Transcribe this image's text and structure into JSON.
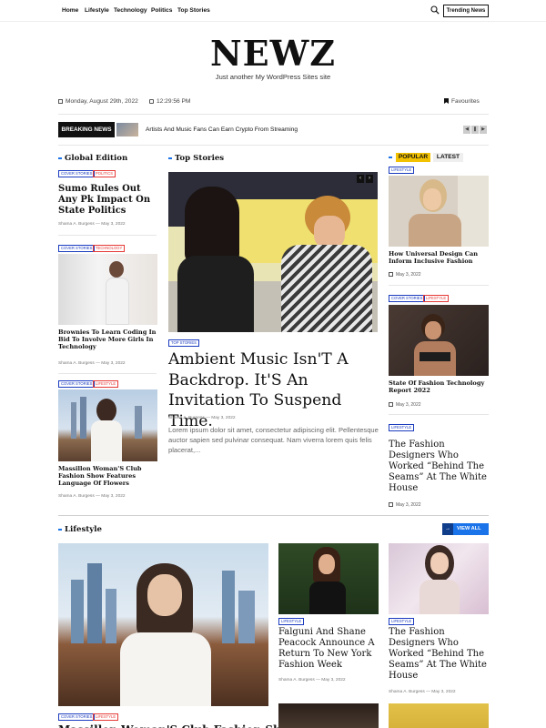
{
  "nav": {
    "items": [
      "Home",
      "Lifestyle",
      "Technology",
      "Politics",
      "Top Stories"
    ],
    "trending_label": "Trending News",
    "search_icon": "search-icon"
  },
  "site": {
    "title": "NEWZ",
    "tagline": "Just another My WordPress Sites site"
  },
  "meta": {
    "date": "Monday, August 29th, 2022",
    "time": "12:29:56 PM",
    "favourites": "Favourites"
  },
  "breaking": {
    "label": "BREAKING NEWS",
    "headline": "Artists And Music Fans Can Earn Crypto From Streaming"
  },
  "global_edition": {
    "heading": "Global Edition",
    "posts": [
      {
        "badges": [
          "COVER STORIES",
          "POLITICS"
        ],
        "title": "Sumo Rules Out Any Pk Impact On State Politics",
        "author": "Shama A. Burgess",
        "date": "May 3, 2022"
      },
      {
        "badges": [
          "COVER STORIES",
          "TECHNOLOGY"
        ],
        "title": "Brownies To Learn Coding In Bid To Involve More Girls In Technology",
        "author": "Shama A. Burgess",
        "date": "May 3, 2022"
      },
      {
        "badges": [
          "COVER STORIES",
          "LIFESTYLE"
        ],
        "title": "Massillon Woman'S Club Fashion Show Features Language Of Flowers",
        "author": "Shama A. Burgess",
        "date": "May 3, 2022"
      }
    ]
  },
  "top_stories": {
    "heading": "Top Stories",
    "badge": "TOP STORIES",
    "title": "Ambient Music Isn'T A Backdrop. It'S An Invitation To Suspend Time.",
    "author": "Shama A. Burgess",
    "date": "May 3, 2022",
    "excerpt": "Lorem ipsum dolor sit amet, consectetur adipiscing elit. Pellentesque auctor sapien sed pulvinar consequat. Nam viverra lorem quis felis placerat,..."
  },
  "popular": {
    "tabs": [
      "POPULAR",
      "LATEST"
    ],
    "posts": [
      {
        "badges": [
          "LIFESTYLE"
        ],
        "title": "How Universal Design Can Inform Inclusive Fashion",
        "date": "May 3, 2022"
      },
      {
        "badges": [
          "COVER STORIES",
          "LIFESTYLE"
        ],
        "title": "State Of Fashion Technology Report 2022",
        "date": "May 3, 2022"
      },
      {
        "badges": [
          "LIFESTYLE"
        ],
        "title": "The Fashion Designers Who Worked “Behind The Seams” At The White House",
        "date": "May 3, 2022"
      }
    ]
  },
  "lifestyle": {
    "heading": "Lifestyle",
    "view_all": "VIEW ALL",
    "featured_badges": [
      "COVER STORIES",
      "LIFESTYLE"
    ],
    "featured_title": "Massillon Woman'S Club Fashion Show Features",
    "posts": [
      {
        "badge": "LIFESTYLE",
        "title": "Falguni And Shane Peacock Announce A Return To New York Fashion Week",
        "author": "Shama A. Burgess",
        "date": "May 3, 2022"
      },
      {
        "badge": "LIFESTYLE",
        "title": "The Fashion Designers Who Worked “Behind The Seams” At The White House",
        "author": "Shama A. Burgess",
        "date": "May 3, 2022"
      }
    ]
  },
  "colors": {
    "accent": "#1a73e8",
    "popular_tab": "#f2c200",
    "badge_blue": "#1a3bbf",
    "badge_red": "#e53935"
  }
}
